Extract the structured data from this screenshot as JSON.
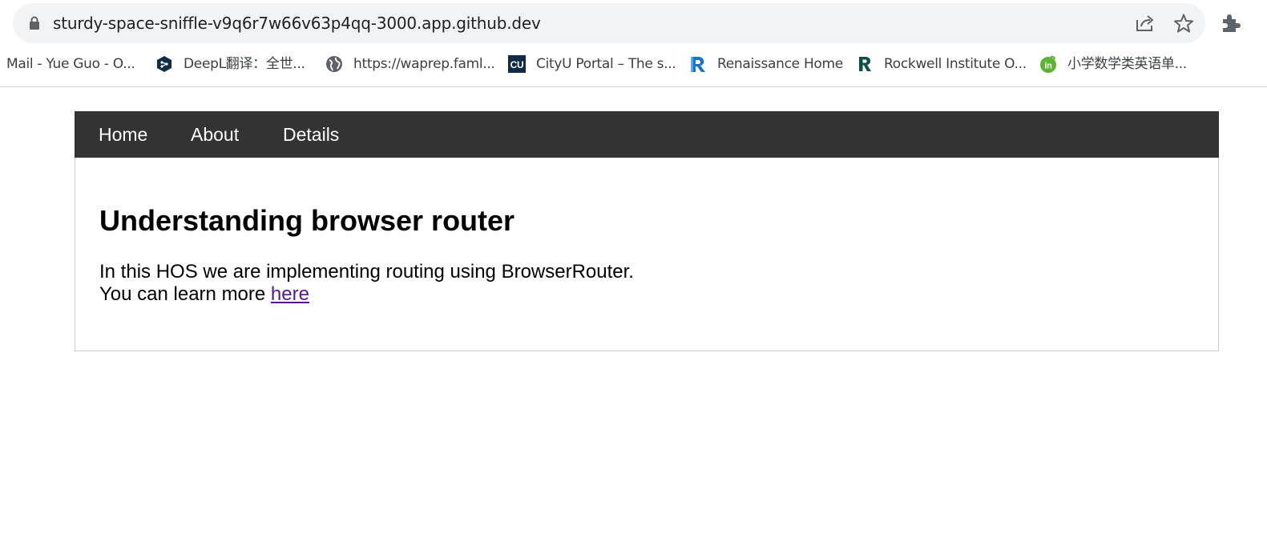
{
  "browser": {
    "url": "sturdy-space-sniffle-v9q6r7w66v63p4qq-3000.app.github.dev",
    "icons": [
      "lock-icon",
      "share-icon",
      "star-icon",
      "extensions-icon"
    ],
    "bookmarks": [
      {
        "label": "Mail - Yue Guo - O...",
        "icon": "none"
      },
      {
        "label": "DeepL翻译：全世...",
        "icon": "deepl-icon"
      },
      {
        "label": "https://waprep.faml...",
        "icon": "globe-icon"
      },
      {
        "label": "CityU Portal – The s...",
        "icon": "cityu-icon",
        "icon_text": "CU"
      },
      {
        "label": "Renaissance Home",
        "icon": "renaissance-icon"
      },
      {
        "label": "Rockwell Institute O...",
        "icon": "rockwell-icon"
      },
      {
        "label": "小学数学类英语单...",
        "icon": "vocab-icon",
        "icon_text": "in"
      }
    ]
  },
  "nav": {
    "home": "Home",
    "about": "About",
    "details": "Details"
  },
  "main": {
    "heading": "Understanding browser router",
    "line1": "In this HOS we are implementing routing using BrowserRouter.",
    "line2_prefix": "You can learn more ",
    "link_text": "here"
  },
  "colors": {
    "navbar_bg": "#333333",
    "link_visited": "#551a8b",
    "address_bar_bg": "#f1f3f4"
  }
}
